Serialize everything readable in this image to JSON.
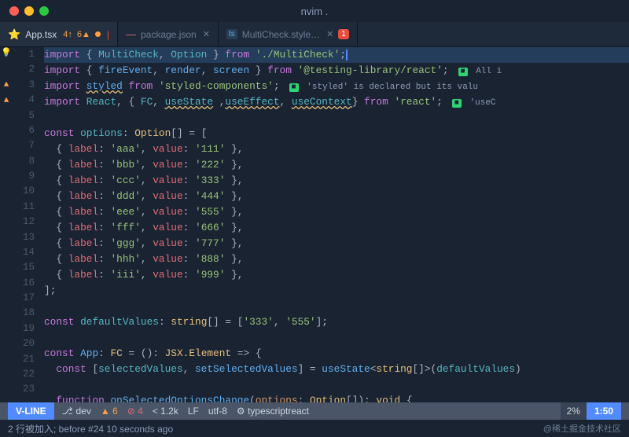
{
  "titleBar": {
    "title": "nvim ."
  },
  "tabs": [
    {
      "id": "app-tsx",
      "icon": "⭐",
      "iconColor": "orange",
      "label": "App.tsx",
      "badge": "4↑6▲",
      "hasDot": true,
      "dotColor": "orange",
      "active": true,
      "hasClose": false
    },
    {
      "id": "package-json",
      "icon": "—",
      "iconColor": "red",
      "label": "package.json",
      "hasClose": true,
      "active": false
    },
    {
      "id": "multicheck-style",
      "icon": "ts",
      "iconColor": "blue",
      "label": "MultiCheck.style…",
      "hasClose": true,
      "active": false,
      "number": "1"
    }
  ],
  "lines": [
    {
      "num": "1",
      "gutter": "💡",
      "content": "import { MultiCheck, Option } from './MultiCheck';"
    },
    {
      "num": "2",
      "gutter": "",
      "content": "import { fireEvent, render, screen } from '@testing-library/react';"
    },
    {
      "num": "3",
      "gutter": "▲",
      "content": "import styled from 'styled-components';"
    },
    {
      "num": "4",
      "gutter": "▲",
      "content": "import React, { FC, useState ,useEffect, useContext} from 'react';"
    },
    {
      "num": "5",
      "gutter": "",
      "content": ""
    },
    {
      "num": "6",
      "gutter": "",
      "content": "const options: Option[] = ["
    },
    {
      "num": "7",
      "gutter": "",
      "content": "  { label: 'aaa', value: '111' },"
    },
    {
      "num": "8",
      "gutter": "",
      "content": "  { label: 'bbb', value: '222' },"
    },
    {
      "num": "9",
      "gutter": "",
      "content": "  { label: 'ccc', value: '333' },"
    },
    {
      "num": "10",
      "gutter": "",
      "content": "  { label: 'ddd', value: '444' },"
    },
    {
      "num": "11",
      "gutter": "",
      "content": "  { label: 'eee', value: '555' },"
    },
    {
      "num": "12",
      "gutter": "",
      "content": "  { label: 'fff', value: '666' },"
    },
    {
      "num": "13",
      "gutter": "",
      "content": "  { label: 'ggg', value: '777' },"
    },
    {
      "num": "14",
      "gutter": "",
      "content": "  { label: 'hhh', value: '888' },"
    },
    {
      "num": "15",
      "gutter": "",
      "content": "  { label: 'iii', value: '999' },"
    },
    {
      "num": "16",
      "gutter": "",
      "content": "];"
    },
    {
      "num": "17",
      "gutter": "",
      "content": ""
    },
    {
      "num": "18",
      "gutter": "",
      "content": "const defaultValues: string[] = ['333', '555'];"
    },
    {
      "num": "19",
      "gutter": "",
      "content": ""
    },
    {
      "num": "20",
      "gutter": "",
      "content": "const App: FC = (): JSX.Element => {"
    },
    {
      "num": "21",
      "gutter": "",
      "content": "  const [selectedValues, setSelectedValues] = useState<string[]>(defaultValues)"
    },
    {
      "num": "22",
      "gutter": "",
      "content": ""
    },
    {
      "num": "23",
      "gutter": "",
      "content": "  function onSelectedOptionsChange(options: Option[]): void {"
    }
  ],
  "statusBar": {
    "mode": "V-LINE",
    "branch": "dev",
    "warnings": "▲ 6",
    "errors": "⊘ 4",
    "fileSize": "< 1.2k",
    "lineEnding": "LF",
    "encoding": "utf-8",
    "filetype": "⚙ typescriptreact",
    "percent": "2%",
    "position": "1:50"
  },
  "messageBar": {
    "message": "2 行被加入; before #24  10 seconds ago",
    "watermark": "@稀土掘金技术社区"
  }
}
